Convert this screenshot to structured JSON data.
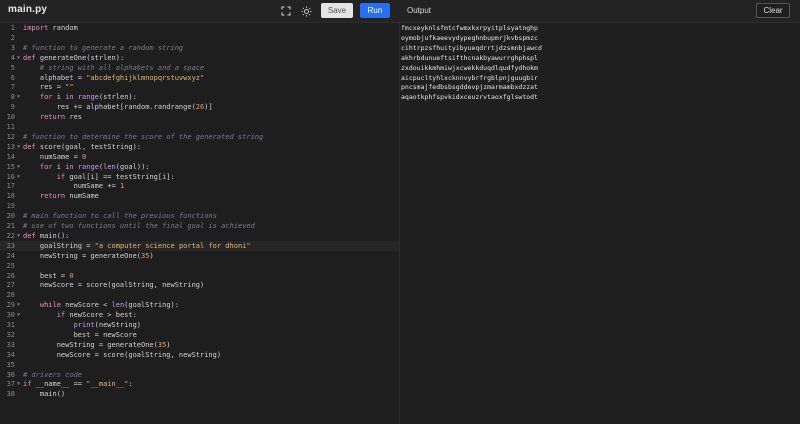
{
  "header": {
    "file_name": "main.py",
    "save_label": "Save",
    "run_label": "Run",
    "output_title": "Output",
    "clear_label": "Clear"
  },
  "editor": {
    "active_line": 23,
    "lines": [
      {
        "n": "1",
        "fold": "",
        "code": "import random"
      },
      {
        "n": "2",
        "fold": "",
        "code": ""
      },
      {
        "n": "3",
        "fold": "",
        "code": "# function to generate a random string"
      },
      {
        "n": "4",
        "fold": "▼",
        "code": "def generateOne(strlen):"
      },
      {
        "n": "5",
        "fold": "",
        "code": "    # string with all alphabets and a space"
      },
      {
        "n": "6",
        "fold": "",
        "code": "    alphabet = \"abcdefghijklmnopqrstuvwxyz\""
      },
      {
        "n": "7",
        "fold": "",
        "code": "    res = \"\""
      },
      {
        "n": "8",
        "fold": "▼",
        "code": "    for i in range(strlen):"
      },
      {
        "n": "9",
        "fold": "",
        "code": "        res += alphabet[random.randrange(26)]"
      },
      {
        "n": "10",
        "fold": "",
        "code": "    return res"
      },
      {
        "n": "11",
        "fold": "",
        "code": ""
      },
      {
        "n": "12",
        "fold": "",
        "code": "# function to determine the score of the generated string"
      },
      {
        "n": "13",
        "fold": "▼",
        "code": "def score(goal, testString):"
      },
      {
        "n": "14",
        "fold": "",
        "code": "    numSame = 0"
      },
      {
        "n": "15",
        "fold": "▼",
        "code": "    for i in range(len(goal)):"
      },
      {
        "n": "16",
        "fold": "▼",
        "code": "        if goal[i] == testString[i]:"
      },
      {
        "n": "17",
        "fold": "",
        "code": "            numSame += 1"
      },
      {
        "n": "18",
        "fold": "",
        "code": "    return numSame"
      },
      {
        "n": "19",
        "fold": "",
        "code": ""
      },
      {
        "n": "20",
        "fold": "",
        "code": "# main function to call the previous functions"
      },
      {
        "n": "21",
        "fold": "",
        "code": "# use of two functions until the final goal is achieved"
      },
      {
        "n": "22",
        "fold": "▼",
        "code": "def main():"
      },
      {
        "n": "23",
        "fold": "",
        "code": "    goalString = \"a computer science portal for dhoni\""
      },
      {
        "n": "24",
        "fold": "",
        "code": "    newString = generateOne(35)"
      },
      {
        "n": "25",
        "fold": "",
        "code": ""
      },
      {
        "n": "26",
        "fold": "",
        "code": "    best = 0"
      },
      {
        "n": "27",
        "fold": "",
        "code": "    newScore = score(goalString, newString)"
      },
      {
        "n": "28",
        "fold": "",
        "code": ""
      },
      {
        "n": "29",
        "fold": "▼",
        "code": "    while newScore < len(goalString):"
      },
      {
        "n": "30",
        "fold": "▼",
        "code": "        if newScore > best:"
      },
      {
        "n": "31",
        "fold": "",
        "code": "            print(newString)"
      },
      {
        "n": "32",
        "fold": "",
        "code": "            best = newScore"
      },
      {
        "n": "33",
        "fold": "",
        "code": "        newString = generateOne(35)"
      },
      {
        "n": "34",
        "fold": "",
        "code": "        newScore = score(goalString, newString)"
      },
      {
        "n": "35",
        "fold": "",
        "code": ""
      },
      {
        "n": "36",
        "fold": "",
        "code": "# drivers code"
      },
      {
        "n": "37",
        "fold": "▼",
        "code": "if __name__ == \"__main__\":"
      },
      {
        "n": "38",
        "fold": "",
        "code": "    main()"
      }
    ]
  },
  "output": {
    "lines": [
      "fmcxeyknlsfmtcfwmxkxrpyitplsyatnghp",
      "oymobjufkaeevydypeghnbupmrjkvbspmzc",
      "cihtrpzsfhuityibyueqdrrtjdzsmnbjawcd",
      "akhrbdunueftsifthcnakbyawurrghphspl",
      "zxdouikkmhmiwjxcwekkduqdlqudfydhokm",
      "aicpucltyhlxcknnvybrfrgblpnjguugbir",
      "pncsmajfedbsbsgddevpjzmarmambxdzzat",
      "aqaotkphfspvkidxceuzrvtaoxfglswtodt"
    ]
  },
  "icons": {
    "fullscreen": "fullscreen-icon",
    "theme": "sun-icon"
  },
  "colors": {
    "run_button": "#2a6ff0",
    "background": "#1e1e1e"
  }
}
